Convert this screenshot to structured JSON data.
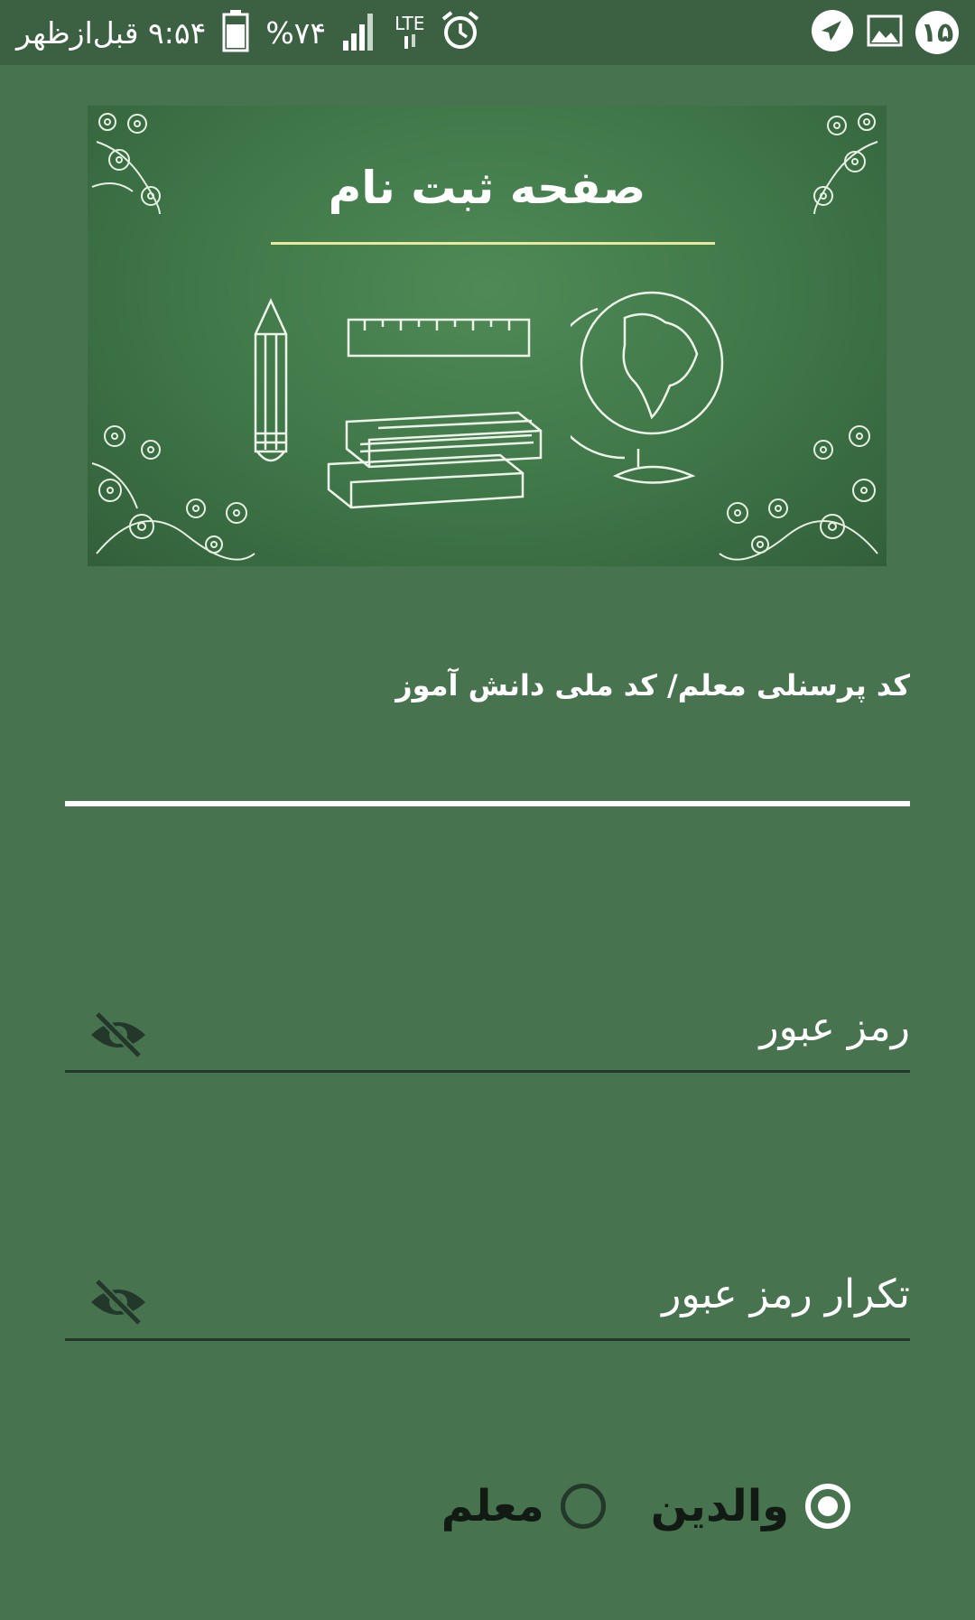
{
  "status_bar": {
    "time": "۹:۵۴ قبل‌ازظهر",
    "battery_percent": "%۷۴",
    "network": "LTE",
    "notification_count": "۱۵",
    "icons": [
      "alarm-icon",
      "signal-icon",
      "battery-icon",
      "telegram-icon",
      "gallery-icon"
    ]
  },
  "banner": {
    "title": "صفحه ثبت نام"
  },
  "form": {
    "id_label": "کد پرسنلی معلم/ کد ملی دانش آموز",
    "id_value": "",
    "password_placeholder": "رمز عبور",
    "password_repeat_placeholder": "تکرار رمز عبور"
  },
  "role": {
    "options": [
      {
        "label": "والدین",
        "selected": true
      },
      {
        "label": "معلم",
        "selected": false
      }
    ]
  },
  "colors": {
    "background": "#47734e",
    "status_bar": "#3b6142",
    "underline_dark": "#23382a",
    "accent": "#ffffff"
  }
}
